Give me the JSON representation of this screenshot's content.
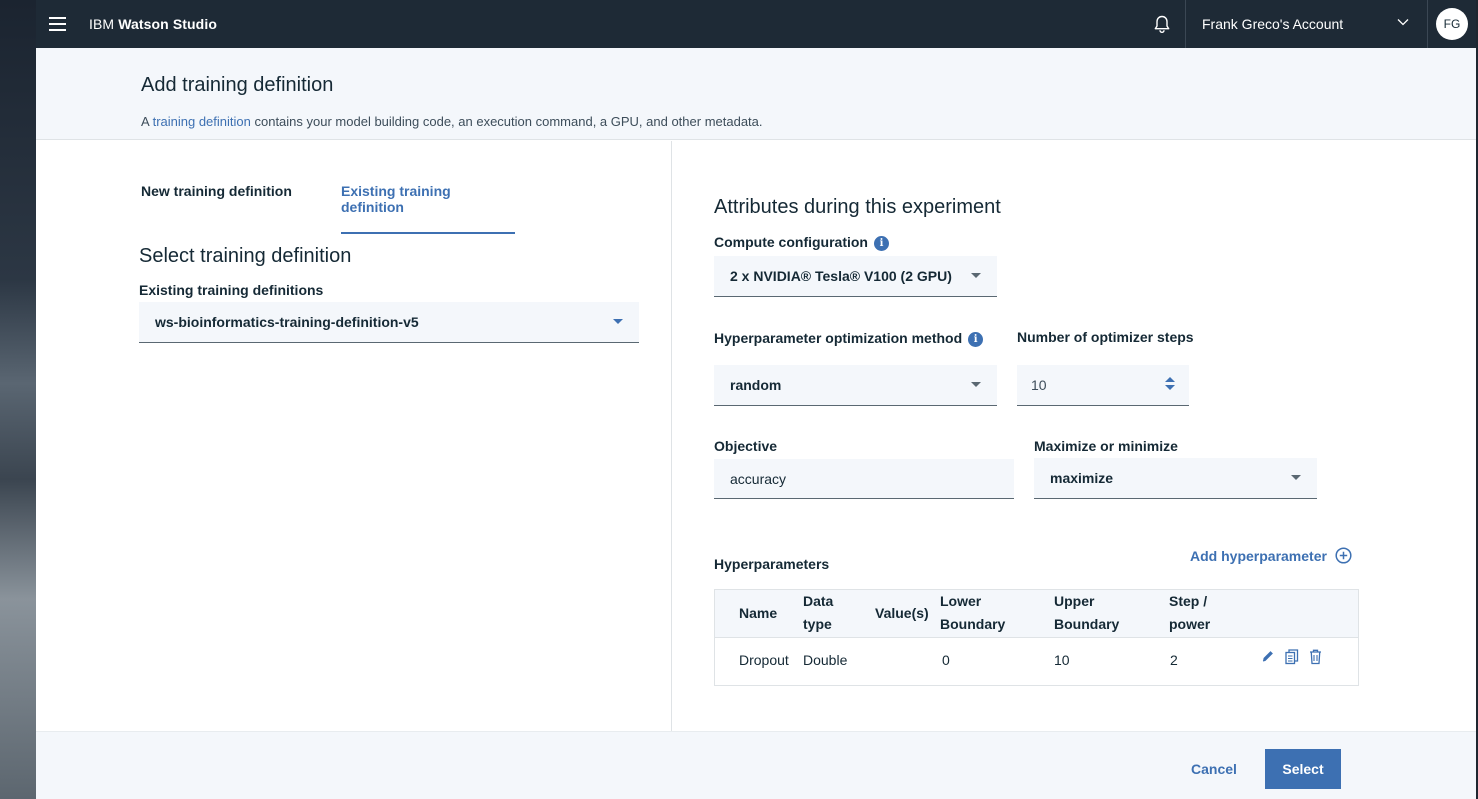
{
  "topbar": {
    "brand_prefix": "IBM",
    "brand_name": "Watson Studio",
    "account_name": "Frank Greco's Account",
    "avatar_initials": "FG",
    "icons": [
      "hamburger-icon",
      "bell-icon",
      "chevron-down-icon"
    ]
  },
  "header": {
    "title": "Add training definition",
    "desc_prefix": "A ",
    "desc_link": "training definition",
    "desc_suffix": " contains your model building code,  an execution command, a GPU, and other metadata."
  },
  "left": {
    "tabs": [
      {
        "label": "New training definition",
        "active": false
      },
      {
        "label": "Existing training definition",
        "active": true
      }
    ],
    "section_title": "Select training definition",
    "existing_label": "Existing training definitions",
    "existing_value": "ws-bioinformatics-training-definition-v5"
  },
  "right": {
    "title": "Attributes during this experiment",
    "compute_label": "Compute configuration",
    "compute_value": "2 x NVIDIA® Tesla® V100 (2 GPU)",
    "hpo_label": "Hyperparameter optimization method",
    "hpo_value": "random",
    "steps_label": "Number of optimizer steps",
    "steps_value": "10",
    "objective_label": "Objective",
    "objective_value": "accuracy",
    "maxmin_label": "Maximize or minimize",
    "maxmin_value": "maximize",
    "hyper_label": "Hyperparameters",
    "add_hyper_label": "Add hyperparameter",
    "table": {
      "headers": {
        "name": "Name",
        "data_type_1": "Data",
        "data_type_2": "type",
        "values": "Value(s)",
        "lower_1": "Lower",
        "lower_2": "Boundary",
        "upper_1": "Upper",
        "upper_2": "Boundary",
        "step_1": "Step /",
        "step_2": "power"
      },
      "rows": [
        {
          "name": "Dropout",
          "data_type": "Double",
          "values": "",
          "lower": "0",
          "upper": "10",
          "step": "2"
        }
      ]
    }
  },
  "footer": {
    "cancel_label": "Cancel",
    "select_label": "Select"
  },
  "colors": {
    "accent": "#3d70b2",
    "topbar": "#1e2a36",
    "field_bg": "#f4f7fb"
  }
}
